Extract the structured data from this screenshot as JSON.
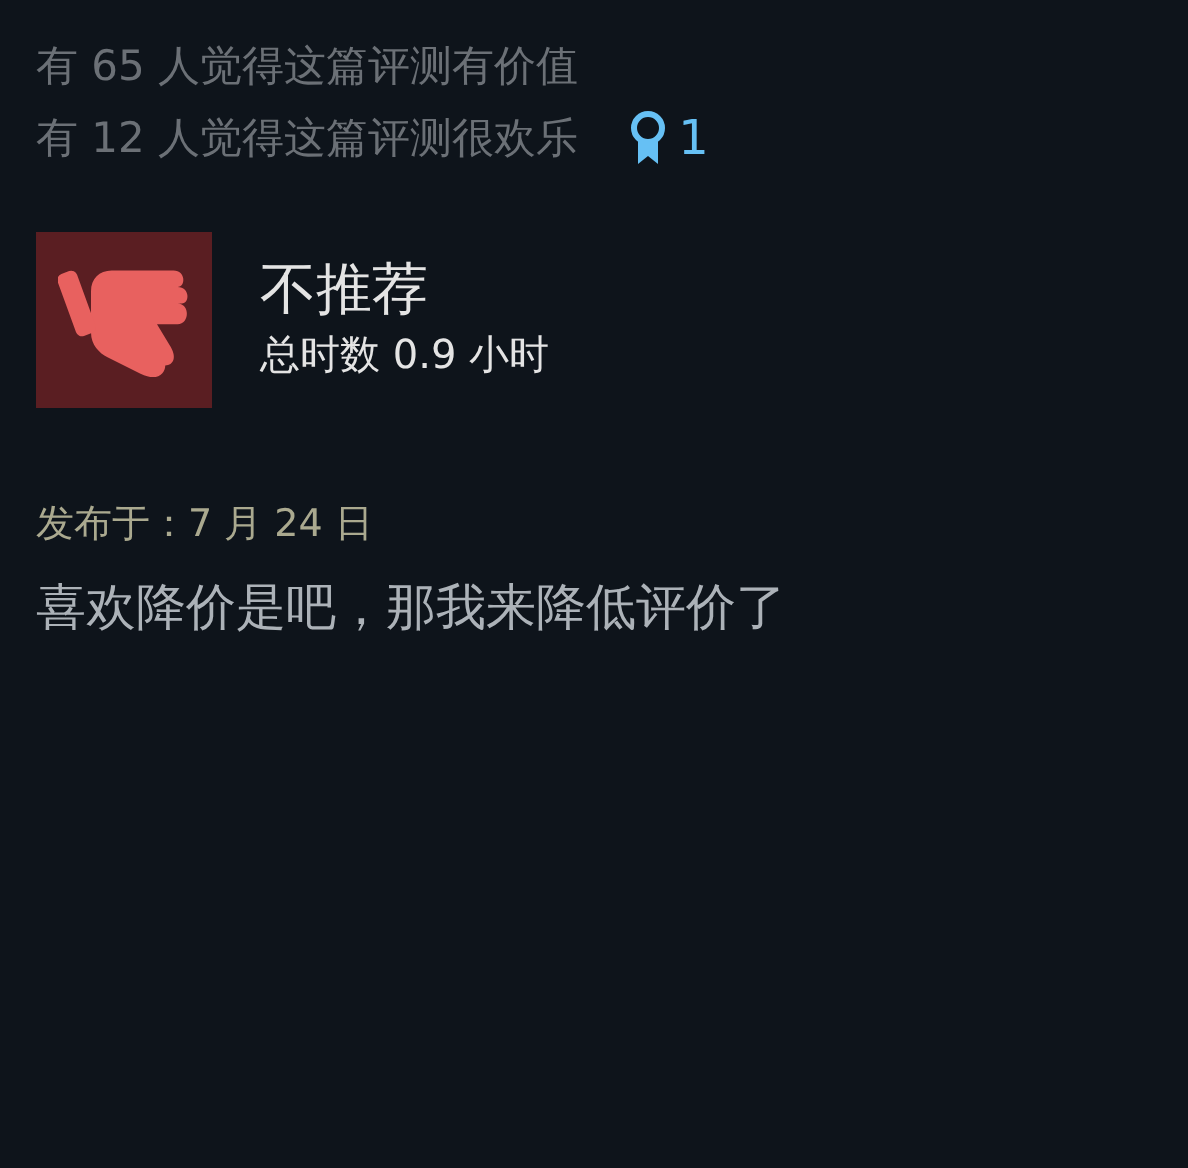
{
  "helpful_lines": [
    "有 65 人觉得这篇评测有价值",
    "有 12 人觉得这篇评测很欢乐"
  ],
  "award": {
    "count": "1"
  },
  "review": {
    "recommended": false,
    "verdict": "不推荐",
    "hours": "总时数 0.9 小时",
    "posted": "发布于：7 月 24 日",
    "body": "喜欢降价是吧，那我来降低评价了"
  }
}
